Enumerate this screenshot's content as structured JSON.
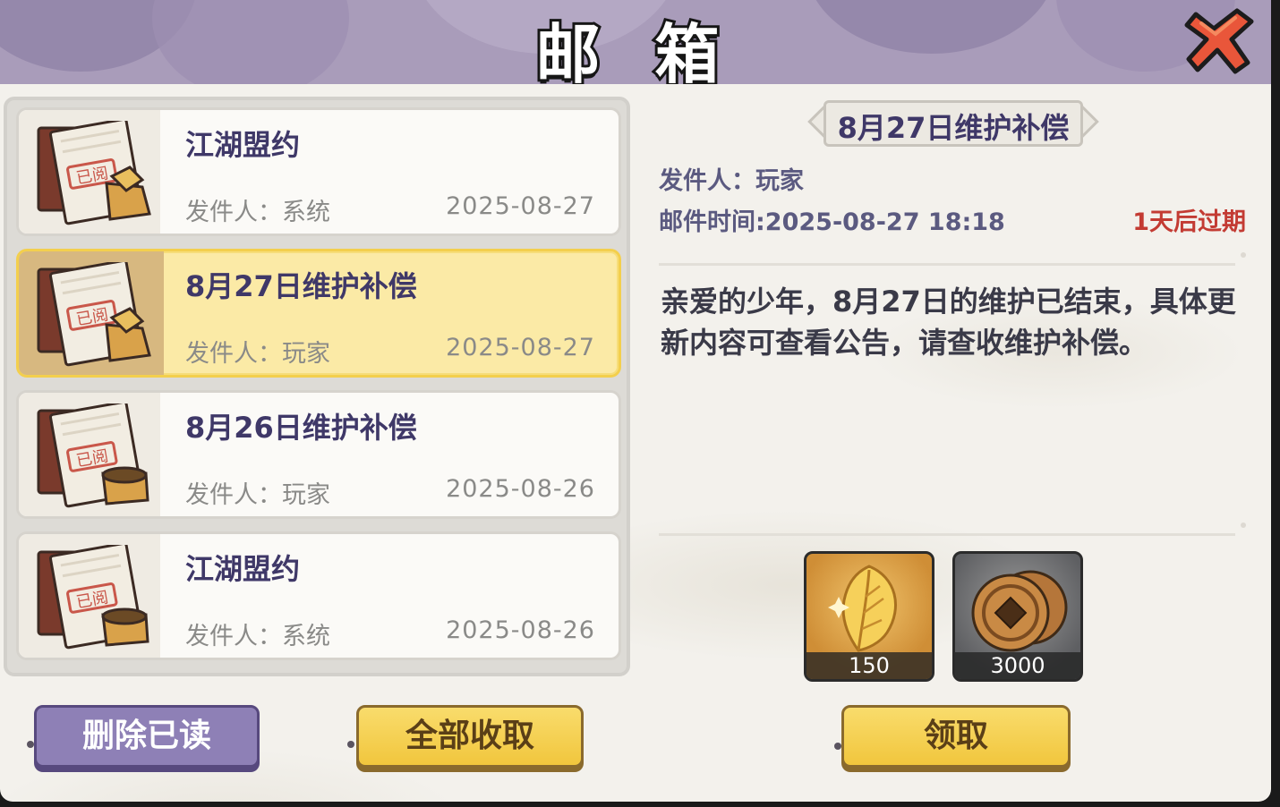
{
  "header": {
    "title": "邮 箱",
    "close_icon": "close-x-icon"
  },
  "mail_list": [
    {
      "title": "江湖盟约",
      "sender": "发件人：系统",
      "date": "2025-08-27",
      "selected": false,
      "stamp": "已阅"
    },
    {
      "title": "8月27日维护补偿",
      "sender": "发件人：玩家",
      "date": "2025-08-27",
      "selected": true,
      "stamp": "已阅"
    },
    {
      "title": "8月26日维护补偿",
      "sender": "发件人：玩家",
      "date": "2025-08-26",
      "selected": false,
      "stamp": "已阅"
    },
    {
      "title": "江湖盟约",
      "sender": "发件人：系统",
      "date": "2025-08-26",
      "selected": false,
      "stamp": "已阅"
    }
  ],
  "buttons": {
    "delete_read": "删除已读",
    "collect_all": "全部收取",
    "claim": "领取"
  },
  "detail": {
    "title": "8月27日维护补偿",
    "sender": "发件人：玩家",
    "time": "邮件时间:2025-08-27 18:18",
    "expire": "1天后过期",
    "body": "亲爱的少年，8月27日的维护已结束，具体更新内容可查看公告，请查收维护补偿。"
  },
  "rewards": [
    {
      "name": "gold-leaf-icon",
      "qty": "150"
    },
    {
      "name": "copper-coin-icon",
      "qty": "3000"
    }
  ],
  "colors": {
    "header_bg": "#a99cba",
    "title_text": "#3f3868",
    "expire_red": "#c33b33",
    "selected_bg": "#fbeaa6",
    "button_yellow": "#f6d050",
    "button_purple": "#8e80b6"
  }
}
